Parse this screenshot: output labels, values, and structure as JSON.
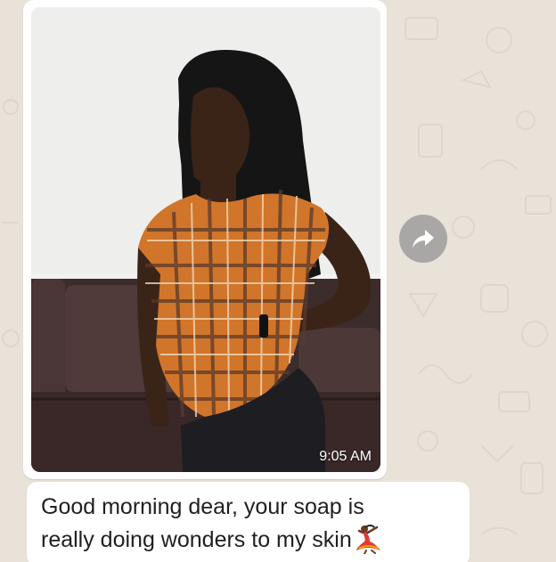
{
  "chat": {
    "image_message": {
      "timestamp": "9:05 AM"
    },
    "text_message": {
      "text": "Good morning dear, your soap is really doing wonders to my skin",
      "emoji": "dancer-emoji"
    }
  },
  "icons": {
    "forward": "forward-arrow-icon"
  },
  "colors": {
    "chat_background": "#e9e2d9",
    "bubble": "#ffffff",
    "forward_button": "#a9a7a5",
    "emoji_red": "#e53935",
    "emoji_gold": "#f4a300"
  }
}
